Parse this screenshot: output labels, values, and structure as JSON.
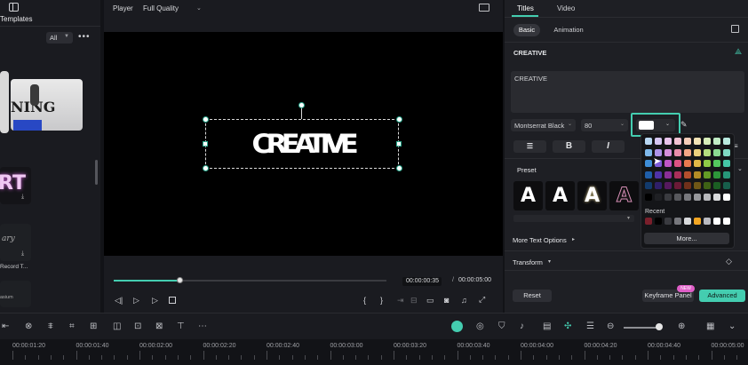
{
  "left_panel": {
    "templates_label": "Templates",
    "filter_value": "All",
    "more_label": "•••",
    "thumb_1_text": "NING",
    "thumb_2_text": "RT",
    "thumb_3_text": "ary",
    "thumb_3_caption": "Record T...",
    "thumb_4_caption": "asium"
  },
  "player": {
    "player_label": "Player",
    "quality_label": "Full Quality",
    "canvas_text": "CREATIVE",
    "current_time": "00:00:00:35",
    "time_separator": "/",
    "total_time": "00:00:05:00",
    "progress": 0.24
  },
  "right_panel": {
    "tabs": [
      "Titles",
      "Video"
    ],
    "active_tab": "Titles",
    "subtabs": [
      "Basic",
      "Animation"
    ],
    "active_subtab": "Basic",
    "title_name": "CREATIVE",
    "text_content": "CREATIVE",
    "font_name": "Montserrat Black",
    "font_size": "80",
    "format_buttons": [
      "B",
      "I"
    ],
    "preset_label": "Preset",
    "preset_letter": "A",
    "more_text_options": "More Text Options",
    "transform_label": "Transform",
    "reset_label": "Reset",
    "keyframe_label": "Keyframe Panel",
    "new_badge": "NEW",
    "advanced_label": "Advanced"
  },
  "color_popup": {
    "recent_label": "Recent",
    "more_label": "More...",
    "selected_color": "#ffffff",
    "accent": "#44cdb0",
    "grid_colors": [
      [
        "#b9d8f3",
        "#d6c6f2",
        "#e9c3ec",
        "#f3c2d3",
        "#f7cdb9",
        "#f3e3b5",
        "#d7eeb9",
        "#c1ecc5",
        "#b9eadf"
      ],
      [
        "#7eb8ea",
        "#ad93e8",
        "#d58edb",
        "#e98cab",
        "#f3a585",
        "#ecd07c",
        "#b4de7e",
        "#8bdb92",
        "#7fd9c3"
      ],
      [
        "#3e8ed8",
        "#7d5ad8",
        "#bf55c6",
        "#dd5283",
        "#ea7a4f",
        "#e2b947",
        "#8fcb46",
        "#53c85e",
        "#45c6a6"
      ],
      [
        "#1f5ea9",
        "#4f33a8",
        "#8a2e97",
        "#aa2f5a",
        "#b44f2d",
        "#b38c25",
        "#649b25",
        "#2d963a",
        "#279679"
      ],
      [
        "#123a6c",
        "#2f1f6a",
        "#56195f",
        "#6b1a37",
        "#70301a",
        "#6f5716",
        "#3e6115",
        "#1b5e23",
        "#175e4b"
      ],
      [
        "#000000",
        "#1f2024",
        "#3a3b40",
        "#57585d",
        "#77787d",
        "#97989c",
        "#b8b9bc",
        "#d9dadc",
        "#ffffff"
      ]
    ],
    "recent_colors": [
      "#7a1f2b",
      "#000000",
      "#3a3b40",
      "#77787d",
      "#d9dadc",
      "#f3a623",
      "#b9bac0",
      "#ffffff",
      "#ffffff"
    ]
  },
  "timeline": {
    "ticks": [
      "00:00:01:20",
      "00:00:01:40",
      "00:00:02:00",
      "00:00:02:20",
      "00:00:02:40",
      "00:00:03:00",
      "00:00:03:20",
      "00:00:03:40",
      "00:00:04:00",
      "00:00:04:20",
      "00:00:04:40",
      "00:00:05:00"
    ]
  }
}
